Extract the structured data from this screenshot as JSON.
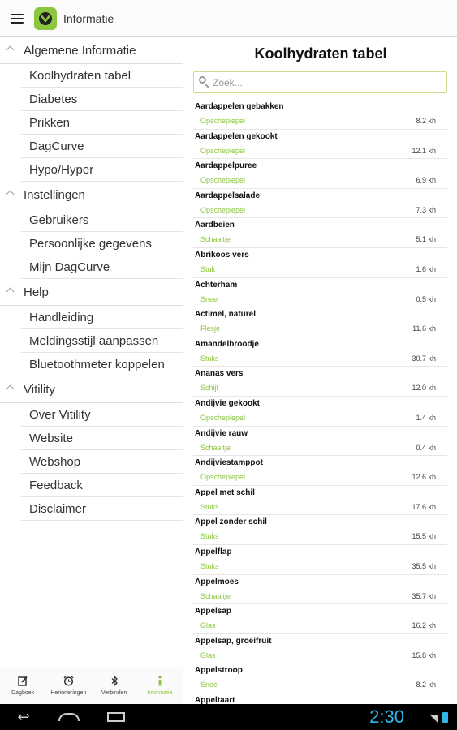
{
  "header": {
    "title": "Informatie"
  },
  "sidebar": {
    "groups": [
      {
        "label": "Algemene Informatie",
        "items": [
          "Koolhydraten tabel",
          "Diabetes",
          "Prikken",
          "DagCurve",
          "Hypo/Hyper"
        ]
      },
      {
        "label": "Instellingen",
        "items": [
          "Gebruikers",
          "Persoonlijke gegevens",
          "Mijn DagCurve"
        ]
      },
      {
        "label": "Help",
        "items": [
          "Handleiding",
          "Meldingsstijl aanpassen",
          "Bluetoothmeter koppelen"
        ]
      },
      {
        "label": "Vitility",
        "items": [
          "Over Vitility",
          "Website",
          "Webshop",
          "Feedback",
          "Disclaimer"
        ]
      }
    ]
  },
  "tabs": [
    {
      "label": "Dagboek",
      "icon": "edit-icon"
    },
    {
      "label": "Herinneringen",
      "icon": "alarm-icon"
    },
    {
      "label": "Verbinden",
      "icon": "bluetooth-icon"
    },
    {
      "label": "Informatie",
      "icon": "info-icon",
      "active": true
    }
  ],
  "main": {
    "title": "Koolhydraten tabel",
    "search_placeholder": "Zoek...",
    "foods": [
      {
        "name": "Aardappelen gebakken",
        "unit": "Opscheplepel",
        "kh": "8.2 kh"
      },
      {
        "name": "Aardappelen gekookt",
        "unit": "Opscheplepel",
        "kh": "12.1 kh"
      },
      {
        "name": "Aardappelpuree",
        "unit": "Opscheplepel",
        "kh": "6.9 kh"
      },
      {
        "name": "Aardappelsalade",
        "unit": "Opscheplepel",
        "kh": "7.3 kh"
      },
      {
        "name": "Aardbeien",
        "unit": "Schaaltje",
        "kh": "5.1 kh"
      },
      {
        "name": "Abrikoos vers",
        "unit": "Stuk",
        "kh": "1.6 kh"
      },
      {
        "name": "Achterham",
        "unit": "Snee",
        "kh": "0.5 kh"
      },
      {
        "name": "Actimel, naturel",
        "unit": "Flesje",
        "kh": "11.6 kh"
      },
      {
        "name": "Amandelbroodje",
        "unit": "Stuks",
        "kh": "30.7 kh"
      },
      {
        "name": "Ananas vers",
        "unit": "Schijf",
        "kh": "12.0 kh"
      },
      {
        "name": "Andijvie gekookt",
        "unit": "Opscheplepel",
        "kh": "1.4 kh"
      },
      {
        "name": "Andijvie rauw",
        "unit": "Schaaltje",
        "kh": "0.4 kh"
      },
      {
        "name": "Andijviestamppot",
        "unit": "Opscheplepel",
        "kh": "12.6 kh"
      },
      {
        "name": "Appel met schil",
        "unit": "Stuks",
        "kh": "17.6 kh"
      },
      {
        "name": "Appel zonder schil",
        "unit": "Stuks",
        "kh": "15.5 kh"
      },
      {
        "name": "Appelflap",
        "unit": "Stuks",
        "kh": "35.5 kh"
      },
      {
        "name": "Appelmoes",
        "unit": "Schaaltje",
        "kh": "35.7 kh"
      },
      {
        "name": "Appelsap",
        "unit": "Glas",
        "kh": "16.2 kh"
      },
      {
        "name": "Appelsap, groeifruit",
        "unit": "Glas",
        "kh": "15.8 kh"
      },
      {
        "name": "Appelstroop",
        "unit": "Snee",
        "kh": "8.2 kh"
      },
      {
        "name": "Appeltaart",
        "unit": "",
        "kh": ""
      }
    ]
  },
  "statusbar": {
    "time": "2:30"
  },
  "colors": {
    "accent": "#8cc63f",
    "clock": "#33b5e5"
  }
}
